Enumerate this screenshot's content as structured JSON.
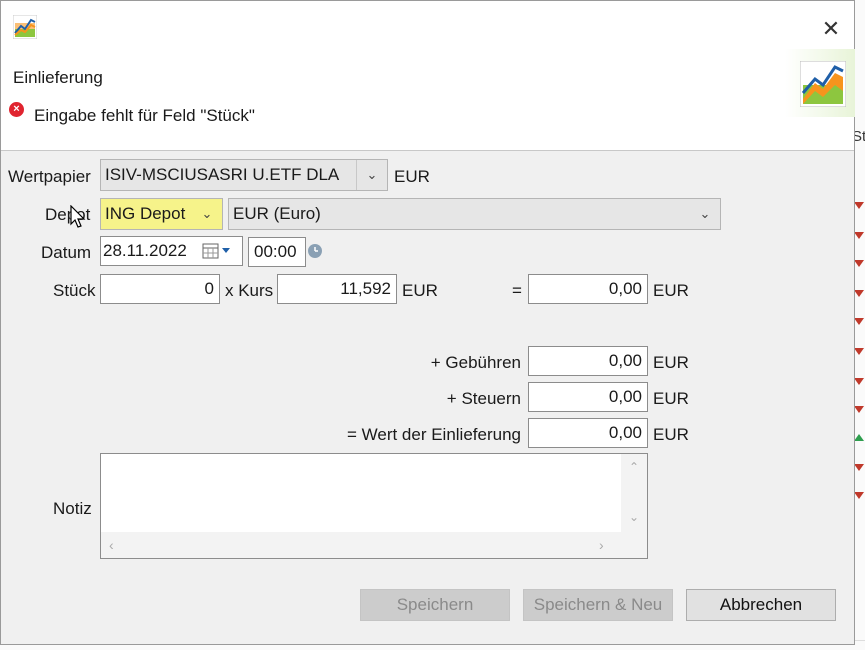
{
  "dialog": {
    "title": "Einlieferung",
    "error_message": "Eingabe fehlt für Feld \"Stück\"",
    "close_symbol": "✕"
  },
  "form": {
    "wertpapier": {
      "label": "Wertpapier",
      "value": "ISIV-MSCIUSASRI U.ETF DLA",
      "currency": "EUR"
    },
    "depot": {
      "label": "Depot",
      "value": "ING Depot",
      "currency_account": "EUR (Euro)"
    },
    "datum": {
      "label": "Datum",
      "date": "28.11.2022",
      "time": "00:00"
    },
    "stueck": {
      "label": "Stück",
      "value": "0",
      "kurs_label": "x Kurs",
      "kurs_value": "11,592",
      "kurs_currency": "EUR",
      "eq_label": "=",
      "total_value": "0,00",
      "total_currency": "EUR"
    },
    "gebuehren": {
      "label": "+ Gebühren",
      "value": "0,00",
      "currency": "EUR"
    },
    "steuern": {
      "label": "+ Steuern",
      "value": "0,00",
      "currency": "EUR"
    },
    "wert": {
      "label": "= Wert der Einlieferung",
      "value": "0,00",
      "currency": "EUR"
    },
    "notiz": {
      "label": "Notiz",
      "value": ""
    }
  },
  "buttons": {
    "save": "Speichern",
    "save_new": "Speichern & Neu",
    "cancel": "Abbrechen"
  },
  "background": {
    "partial_text": "St"
  },
  "colors": {
    "error": "#e0242f",
    "highlight": "#f6f38a",
    "trend_down": "#c0392b",
    "trend_up": "#2e9e4e"
  }
}
